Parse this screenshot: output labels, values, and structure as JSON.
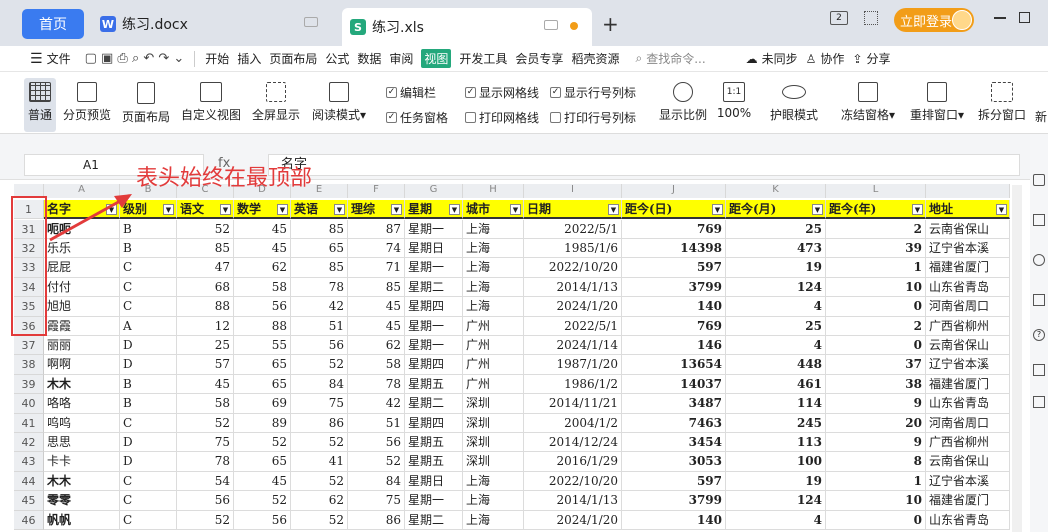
{
  "tabs": {
    "home": "首页",
    "file1": "练习.docx",
    "file2": "练习.xls",
    "login": "立即登录"
  },
  "menu": {
    "file": "文件",
    "items": [
      "开始",
      "插入",
      "页面布局",
      "公式",
      "数据",
      "审阅",
      "视图",
      "开发工具",
      "会员专享",
      "稻壳资源"
    ],
    "active_index": 6,
    "search_placeholder": "查找命令...",
    "sync": "未同步",
    "collab": "协作",
    "share": "分享"
  },
  "ribbon": {
    "normal": "普通",
    "page_break": "分页预览",
    "page_layout": "页面布局",
    "custom_view": "自定义视图",
    "fullscreen": "全屏显示",
    "reading": "阅读模式",
    "formula_bar": "编辑栏",
    "task_pane": "任务窗格",
    "show_grid": "显示网格线",
    "print_grid": "打印网格线",
    "show_header": "显示行号列标",
    "print_header": "打印行号列标",
    "zoom": "显示比例",
    "zoom100": "100%",
    "eye": "护眼模式",
    "freeze": "冻结窗格",
    "arrange": "重排窗口",
    "split": "拆分窗口",
    "new": "新"
  },
  "formula_bar": {
    "cell": "A1",
    "fx": "fx",
    "content": "名字"
  },
  "annotation": "表头始终在最顶部",
  "columns": [
    "A",
    "B",
    "C",
    "D",
    "E",
    "F",
    "G",
    "H",
    "I",
    "J",
    "K",
    "L",
    ""
  ],
  "headers": [
    "名字",
    "级别",
    "语文",
    "数学",
    "英语",
    "理综",
    "星期",
    "城市",
    "日期",
    "距今(日)",
    "距今(月)",
    "距今(年)",
    "地址"
  ],
  "rows": [
    {
      "n": "31",
      "cells": [
        "呃呃",
        "B",
        "52",
        "45",
        "85",
        "87",
        "星期一",
        "上海",
        "2022/5/1",
        "769",
        "25",
        "2",
        "云南省保山"
      ]
    },
    {
      "n": "32",
      "cells": [
        "乐乐",
        "B",
        "85",
        "45",
        "65",
        "74",
        "星期日",
        "上海",
        "1985/1/6",
        "14398",
        "473",
        "39",
        "辽宁省本溪"
      ]
    },
    {
      "n": "33",
      "cells": [
        "屁屁",
        "C",
        "47",
        "62",
        "85",
        "71",
        "星期一",
        "上海",
        "2022/10/20",
        "597",
        "19",
        "1",
        "福建省厦门"
      ]
    },
    {
      "n": "34",
      "cells": [
        "付付",
        "C",
        "68",
        "58",
        "78",
        "85",
        "星期二",
        "上海",
        "2014/1/13",
        "3799",
        "124",
        "10",
        "山东省青岛"
      ]
    },
    {
      "n": "35",
      "cells": [
        "旭旭",
        "C",
        "88",
        "56",
        "42",
        "45",
        "星期四",
        "上海",
        "2024/1/20",
        "140",
        "4",
        "0",
        "河南省周口"
      ]
    },
    {
      "n": "36",
      "cells": [
        "霞霞",
        "A",
        "12",
        "88",
        "51",
        "45",
        "星期一",
        "广州",
        "2022/5/1",
        "769",
        "25",
        "2",
        "广西省柳州"
      ]
    },
    {
      "n": "37",
      "cells": [
        "丽丽",
        "D",
        "25",
        "55",
        "56",
        "62",
        "星期一",
        "广州",
        "2024/1/14",
        "146",
        "4",
        "0",
        "云南省保山"
      ]
    },
    {
      "n": "38",
      "cells": [
        "啊啊",
        "D",
        "57",
        "65",
        "52",
        "58",
        "星期四",
        "广州",
        "1987/1/20",
        "13654",
        "448",
        "37",
        "辽宁省本溪"
      ]
    },
    {
      "n": "39",
      "cells": [
        "木木",
        "B",
        "45",
        "65",
        "84",
        "78",
        "星期五",
        "广州",
        "1986/1/2",
        "14037",
        "461",
        "38",
        "福建省厦门"
      ]
    },
    {
      "n": "40",
      "cells": [
        "咯咯",
        "B",
        "58",
        "69",
        "75",
        "42",
        "星期二",
        "深圳",
        "2014/11/21",
        "3487",
        "114",
        "9",
        "山东省青岛"
      ]
    },
    {
      "n": "41",
      "cells": [
        "呜呜",
        "C",
        "52",
        "89",
        "86",
        "51",
        "星期四",
        "深圳",
        "2004/1/2",
        "7463",
        "245",
        "20",
        "河南省周口"
      ]
    },
    {
      "n": "42",
      "cells": [
        "思思",
        "D",
        "75",
        "52",
        "52",
        "56",
        "星期五",
        "深圳",
        "2014/12/24",
        "3454",
        "113",
        "9",
        "广西省柳州"
      ]
    },
    {
      "n": "43",
      "cells": [
        "卡卡",
        "D",
        "78",
        "65",
        "41",
        "52",
        "星期五",
        "深圳",
        "2016/1/29",
        "3053",
        "100",
        "8",
        "云南省保山"
      ]
    },
    {
      "n": "44",
      "cells": [
        "木木",
        "C",
        "54",
        "45",
        "52",
        "84",
        "星期日",
        "上海",
        "2022/10/20",
        "597",
        "19",
        "1",
        "辽宁省本溪"
      ]
    },
    {
      "n": "45",
      "cells": [
        "零零",
        "C",
        "56",
        "52",
        "62",
        "75",
        "星期一",
        "上海",
        "2014/1/13",
        "3799",
        "124",
        "10",
        "福建省厦门"
      ]
    },
    {
      "n": "46",
      "cells": [
        "帆帆",
        "C",
        "52",
        "56",
        "52",
        "86",
        "星期二",
        "上海",
        "2024/1/20",
        "140",
        "4",
        "0",
        "山东省青岛"
      ]
    }
  ],
  "header_row_number": "1",
  "colors": {
    "accent": "#24a87c",
    "header_fill": "#ffff00",
    "annotation": "#e23b3b",
    "home_tab": "#3a7bf0",
    "login": "#f29d18"
  }
}
